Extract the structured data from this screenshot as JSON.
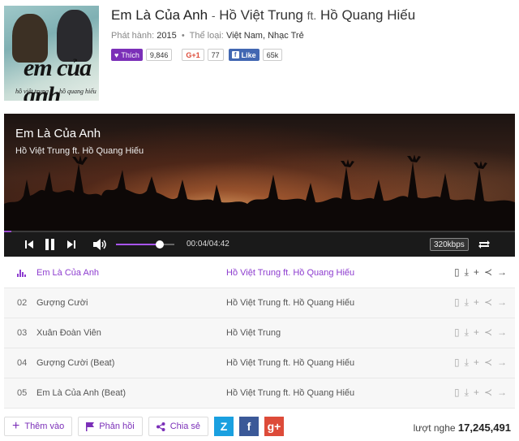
{
  "album": {
    "cover_title": "em của anh",
    "cover_sub1": "hồ việt trung",
    "cover_sub2": "hồ quang hiếu"
  },
  "song": {
    "title": "Em Là Của Anh",
    "separator": "-",
    "artist": "Hồ Việt Trung",
    "ft": "ft.",
    "artist2": "Hồ Quang Hiếu"
  },
  "meta": {
    "release_label": "Phát hành:",
    "release_value": "2015",
    "genre_label": "Thể loại:",
    "genre_value": "Việt Nam, Nhạc Trẻ",
    "dot": "•"
  },
  "social": {
    "like_label": "Thích",
    "like_count": "9,846",
    "gplus_label": "G+1",
    "gplus_count": "77",
    "fb_label": "Like",
    "fb_icon": "f",
    "fb_count": "65k"
  },
  "player": {
    "title": "Em Là Của Anh",
    "artist": "Hồ Việt Trung ft. Hồ Quang Hiếu",
    "time": "00:04/04:42",
    "quality": "320kbps",
    "progress": 0.014,
    "volume": 0.75,
    "accent": "#8d3ccf"
  },
  "tracks": [
    {
      "no": "",
      "name": "Em Là Của Anh",
      "artist": "Hồ Việt Trung  ft.  Hồ Quang Hiếu",
      "active": true
    },
    {
      "no": "02",
      "name": "Gượng Cười",
      "artist": "Hồ Việt Trung  ft.  Hồ Quang Hiếu"
    },
    {
      "no": "03",
      "name": "Xuân Đoàn Viên",
      "artist": "Hồ Việt Trung"
    },
    {
      "no": "04",
      "name": "Gượng Cười (Beat)",
      "artist": "Hồ Việt Trung  ft.  Hồ Quang Hiếu"
    },
    {
      "no": "05",
      "name": "Em Là Của Anh (Beat)",
      "artist": "Hồ Việt Trung  ft.  Hồ Quang Hiếu"
    }
  ],
  "footer": {
    "add_label": "Thêm vào",
    "report_label": "Phản hồi",
    "share_label": "Chia sẻ",
    "zing_label": "Z",
    "facebook_label": "f",
    "gplus_label": "g+",
    "listen_label": "lượt nghe",
    "listen_count": "17,245,491"
  },
  "colors": {
    "brand": "#7b2fb8",
    "facebook": "#3b5998",
    "gplus": "#dd4b39",
    "zing": "#1aa0e0"
  }
}
